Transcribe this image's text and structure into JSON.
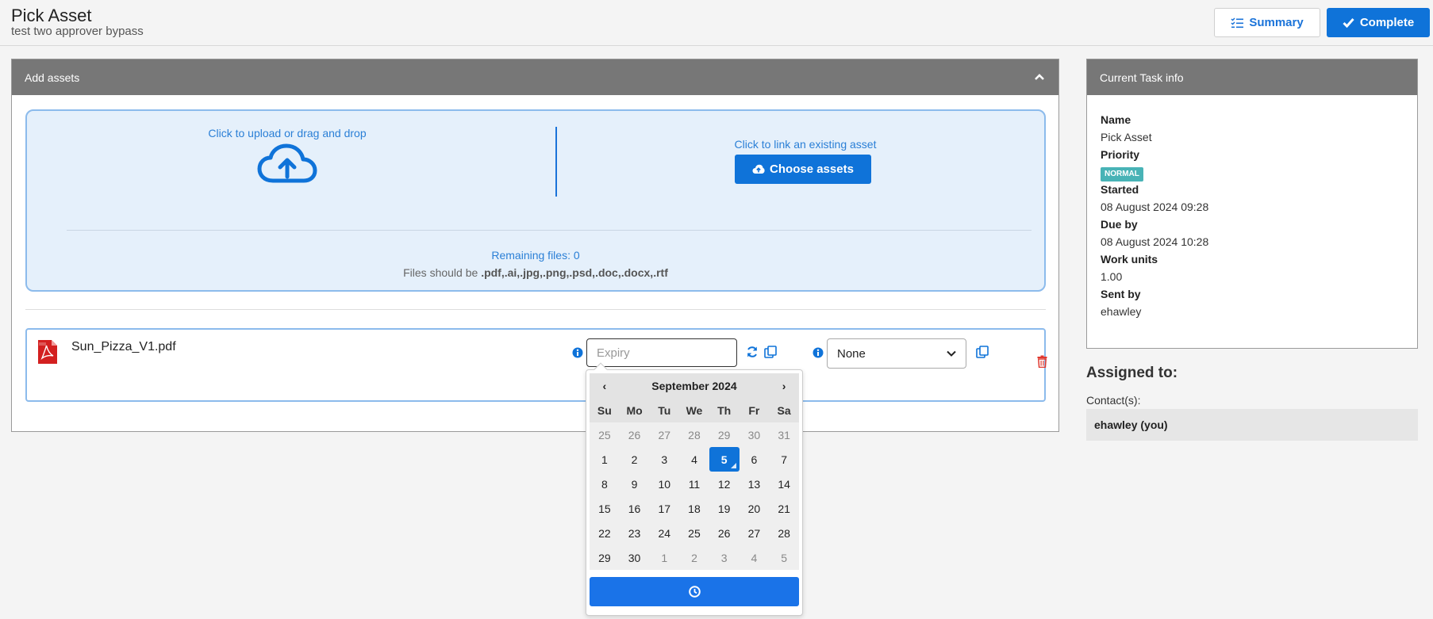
{
  "header": {
    "title": "Pick Asset",
    "subtitle": "test two approver bypass",
    "summary_label": "Summary",
    "complete_label": "Complete"
  },
  "assets_panel": {
    "title": "Add assets",
    "upload_text": "Click to upload or drag and drop",
    "link_text": "Click to link an existing asset",
    "choose_label": "Choose assets",
    "remaining": "Remaining files: 0",
    "files_prefix": "Files should be ",
    "files_types": ".pdf,.ai,.jpg,.png,.psd,.doc,.docx,.rtf"
  },
  "file_row": {
    "file_name": "Sun_Pizza_V1.pdf",
    "expiry_placeholder": "Expiry",
    "select_value": "None"
  },
  "datepicker": {
    "prev": "‹",
    "next": "›",
    "month_label": "September 2024",
    "dow": [
      "Su",
      "Mo",
      "Tu",
      "We",
      "Th",
      "Fr",
      "Sa"
    ],
    "weeks": [
      [
        "25",
        "26",
        "27",
        "28",
        "29",
        "30",
        "31"
      ],
      [
        "1",
        "2",
        "3",
        "4",
        "5",
        "6",
        "7"
      ],
      [
        "8",
        "9",
        "10",
        "11",
        "12",
        "13",
        "14"
      ],
      [
        "15",
        "16",
        "17",
        "18",
        "19",
        "20",
        "21"
      ],
      [
        "22",
        "23",
        "24",
        "25",
        "26",
        "27",
        "28"
      ],
      [
        "29",
        "30",
        "1",
        "2",
        "3",
        "4",
        "5"
      ]
    ],
    "selected_day": "5"
  },
  "task_info": {
    "title": "Current Task info",
    "name_label": "Name",
    "name_value": "Pick Asset",
    "priority_label": "Priority",
    "priority_value": "NORMAL",
    "started_label": "Started",
    "started_value": "08 August 2024 09:28",
    "due_label": "Due by",
    "due_value": "08 August 2024 10:28",
    "work_label": "Work units",
    "work_value": "1.00",
    "sent_label": "Sent by",
    "sent_value": "ehawley"
  },
  "assigned": {
    "title": "Assigned to:",
    "contacts_label": "Contact(s):",
    "contact": "ehawley (you)"
  },
  "colors": {
    "accent": "#0f73d9",
    "panel_header": "#777777",
    "drop_bg": "#e5f0fb",
    "badge": "#48b3b6",
    "danger": "#e0382f"
  }
}
